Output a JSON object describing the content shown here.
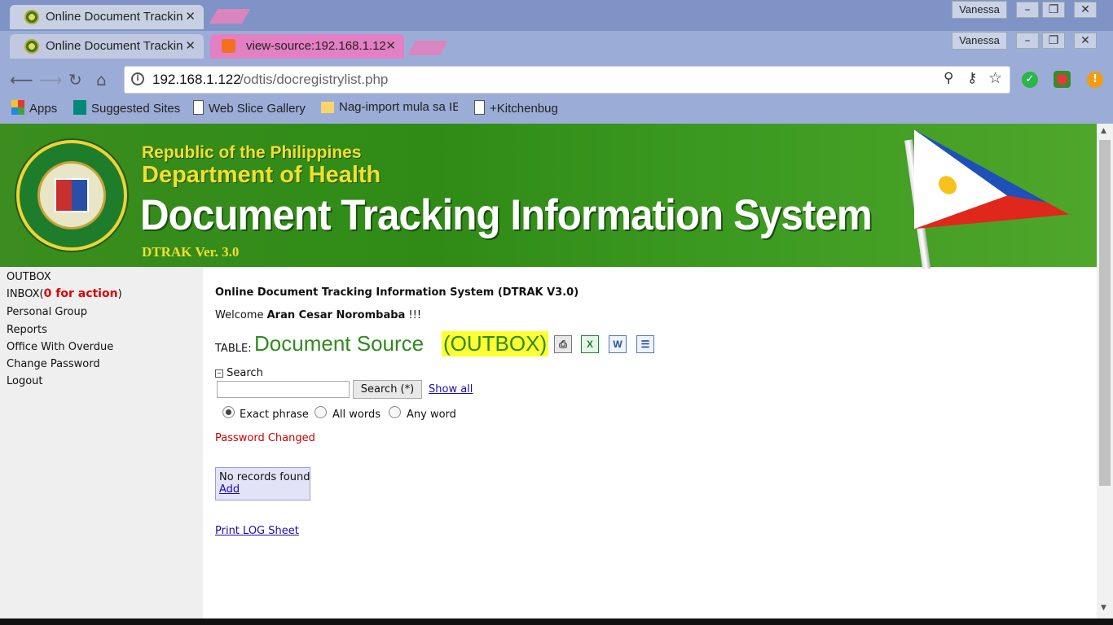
{
  "browser": {
    "back_window": {
      "tab_title": "Online Document Trackin",
      "user": "Vanessa"
    },
    "front_window": {
      "tabs": [
        {
          "title": "Online Document Trackin",
          "active": false
        },
        {
          "title": "view-source:192.168.1.12",
          "active": true
        }
      ],
      "user": "Vanessa"
    },
    "url": {
      "host": "192.168.1.122",
      "path": "/odtis/docregistrylist.php"
    },
    "bookmarks": [
      {
        "label": "Apps",
        "icon": "apps-grid-icon"
      },
      {
        "label": "Suggested Sites",
        "icon": "bing-icon"
      },
      {
        "label": "Web Slice Gallery",
        "icon": "page-icon"
      },
      {
        "label": "Nag-import mula sa IE",
        "icon": "folder-icon"
      },
      {
        "label": "+Kitchenbug",
        "icon": "page-icon"
      }
    ]
  },
  "banner": {
    "line1": "Republic of the Philippines",
    "line2": "Department of Health",
    "title": "Document Tracking Information System",
    "version": "DTRAK Ver. 3.0",
    "seal_top": "REPUBLIC OF THE PHILIPPINES",
    "seal_bottom": "DEPARTMENT OF HEALTH"
  },
  "sidebar": {
    "outbox": "OUTBOX",
    "inbox_prefix": "INBOX(",
    "inbox_action": "0 for action",
    "inbox_suffix": ")",
    "personal_group": "Personal Group",
    "reports": "Reports",
    "office_overdue": "Office With Overdue",
    "change_password": "Change Password",
    "logout": "Logout"
  },
  "main": {
    "system_title": "Online Document Tracking Information System (DTRAK V3.0)",
    "welcome_prefix": "Welcome ",
    "user_name": "Aran Cesar Norombaba",
    "welcome_suffix": " !!!",
    "table_prefix": "TABLE:",
    "table_name": "Document Source",
    "table_highlight": "(OUTBOX)",
    "search": {
      "toggle_label": "Search",
      "input_value": "",
      "button_label": "Search (*)",
      "show_all": "Show all",
      "options": [
        "Exact phrase",
        "All words",
        "Any word"
      ],
      "selected": "Exact phrase"
    },
    "status_message": "Password Changed",
    "no_records": "No records found",
    "add_link": "Add",
    "print_log": "Print LOG Sheet"
  },
  "colors": {
    "chrome": "#9badd6",
    "banner_green": "#2f8b16",
    "banner_text_yellow": "#f2df30",
    "table_name_green": "#2e8b1e",
    "highlight_yellow": "#ffff33",
    "action_red": "#e00000",
    "status_red": "#d00000"
  }
}
